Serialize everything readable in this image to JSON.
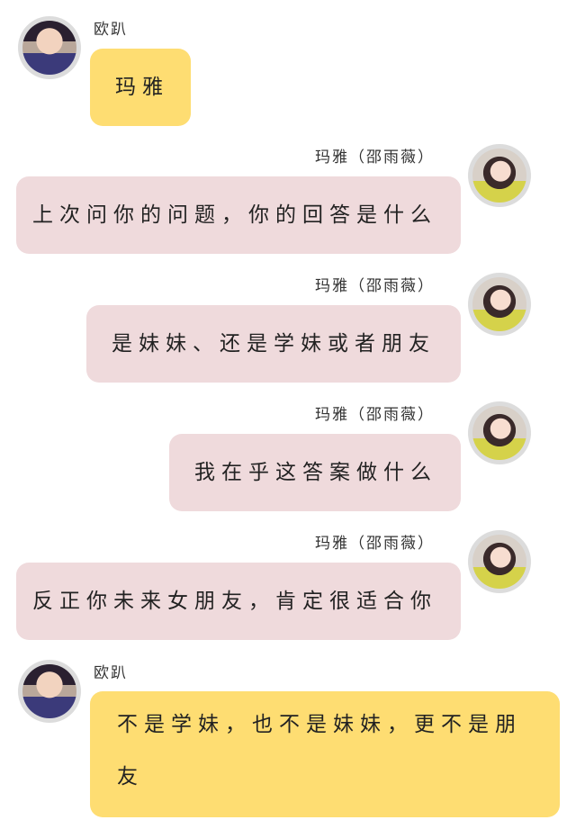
{
  "messages": [
    {
      "sender": "欧趴",
      "text": "玛雅",
      "side": "left",
      "avatar_icon": "boy-avatar-icon"
    },
    {
      "sender": "玛雅（邵雨薇）",
      "text": "上次问你的问题，你的回答是什么",
      "side": "right",
      "avatar_icon": "girl-avatar-icon"
    },
    {
      "sender": "玛雅（邵雨薇）",
      "text": "是妹妹、还是学妹或者朋友",
      "side": "right",
      "avatar_icon": "girl-avatar-icon"
    },
    {
      "sender": "玛雅（邵雨薇）",
      "text": "我在乎这答案做什么",
      "side": "right",
      "avatar_icon": "girl-avatar-icon"
    },
    {
      "sender": "玛雅（邵雨薇）",
      "text": "反正你未来女朋友，肯定很适合你",
      "side": "right",
      "avatar_icon": "girl-avatar-icon"
    },
    {
      "sender": "欧趴",
      "text": "不是学妹，也不是妹妹，更不是朋友",
      "side": "left",
      "avatar_icon": "boy-avatar-icon"
    }
  ],
  "colors": {
    "left_bubble": "#fedd72",
    "right_bubble": "#efdadc",
    "avatar_ring": "#dcdcdc"
  }
}
